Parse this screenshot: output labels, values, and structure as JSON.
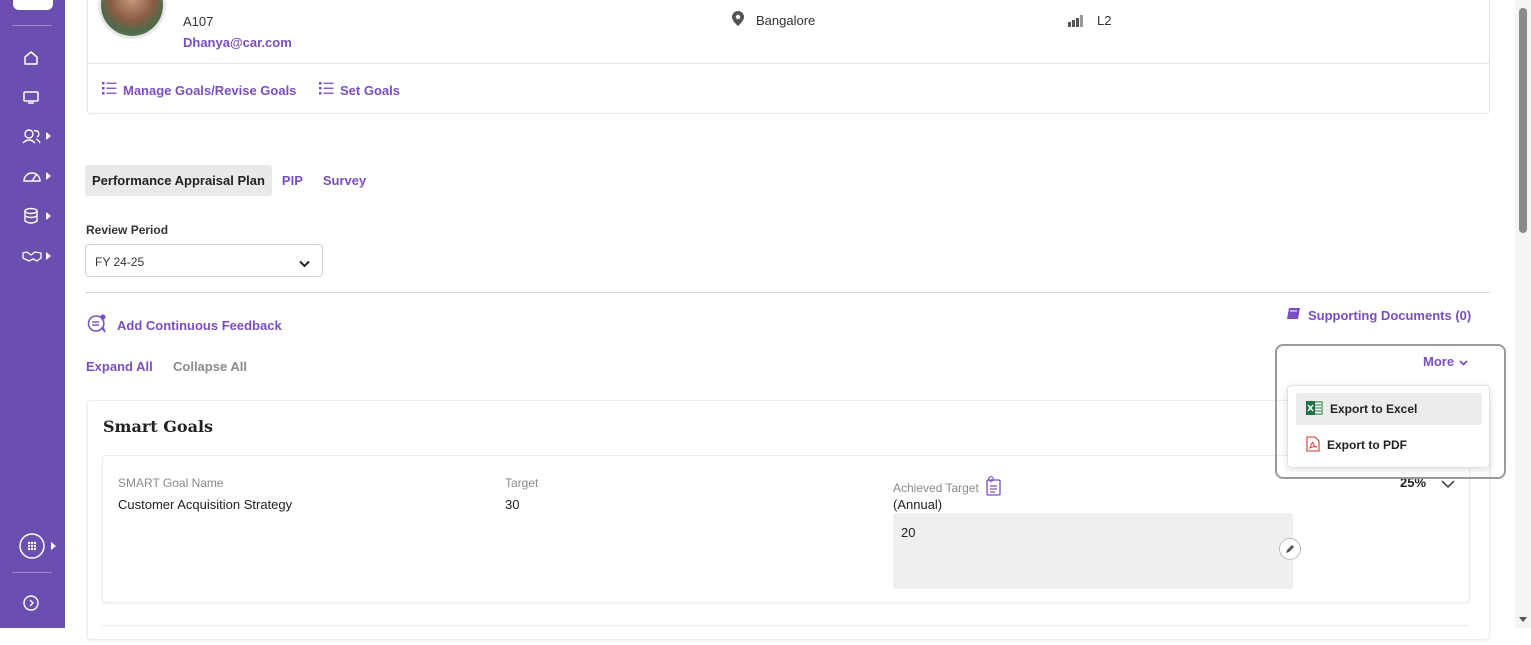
{
  "profile": {
    "emp_code": "A107",
    "email": "Dhanya@car.com",
    "location": "Bangalore",
    "level": "L2"
  },
  "profile_actions": {
    "manage_goals": "Manage Goals/Revise Goals",
    "set_goals": "Set Goals"
  },
  "tabs": [
    {
      "label": "Performance Appraisal Plan",
      "active": true
    },
    {
      "label": "PIP",
      "active": false
    },
    {
      "label": "Survey",
      "active": false
    }
  ],
  "review_period": {
    "label": "Review Period",
    "selected": "FY 24-25"
  },
  "actions": {
    "add_feedback": "Add Continuous Feedback",
    "supporting_documents": "Supporting Documents (0)",
    "expand_all": "Expand All",
    "collapse_all": "Collapse All",
    "more": "More"
  },
  "more_menu": {
    "export_excel": "Export to Excel",
    "export_pdf": "Export to PDF"
  },
  "goals_section": {
    "title": "Smart Goals",
    "columns": {
      "name": "SMART Goal Name",
      "target": "Target",
      "achieved": "Achieved Target",
      "achieved_sub": "(Annual)"
    },
    "rows": [
      {
        "name": "Customer Acquisition Strategy",
        "target": "30",
        "achieved": "20",
        "percent": "25%"
      }
    ]
  },
  "colors": {
    "sidebar": "#6b4fb0",
    "accent": "#7a4ec0",
    "excel_green": "#1e7145",
    "pdf_red": "#d9342b"
  },
  "icons": {
    "sidebar": [
      "home-icon",
      "monitor-icon",
      "people-icon",
      "speedometer-icon",
      "database-icon",
      "handshake-icon",
      "apps-icon",
      "expand-sidebar-icon"
    ],
    "profile": [
      "location-pin-icon",
      "signal-bars-icon"
    ],
    "misc": [
      "list-icon",
      "feedback-icon",
      "book-icon",
      "chevron-down-icon",
      "excel-icon",
      "pdf-icon",
      "clipboard-icon",
      "edit-icon"
    ]
  }
}
